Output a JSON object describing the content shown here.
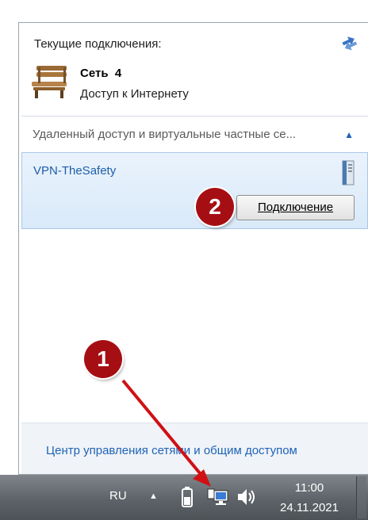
{
  "popup": {
    "current_title": "Текущие подключения:",
    "network": {
      "name": "Сеть  4",
      "status": "Доступ к Интернету"
    },
    "vpn_section_title": "Удаленный доступ и виртуальные частные се...",
    "vpn_item": {
      "name": "VPN-TheSafety",
      "connect_label": "Подключение"
    },
    "footer_link": "Центр управления сетями и общим доступом"
  },
  "taskbar": {
    "language": "RU",
    "time": "11:00",
    "date": "24.11.2021"
  },
  "annotations": {
    "first": "1",
    "second": "2"
  },
  "colors": {
    "accent_red": "#a50f14",
    "link_blue": "#1e63b8"
  },
  "icons": {
    "refresh": "refresh-icon",
    "network": "bench-network-icon",
    "vpn": "server-icon",
    "collapse": "chevron-up-icon",
    "battery": "battery-icon",
    "network_tray": "network-tray-icon",
    "volume": "volume-icon"
  }
}
